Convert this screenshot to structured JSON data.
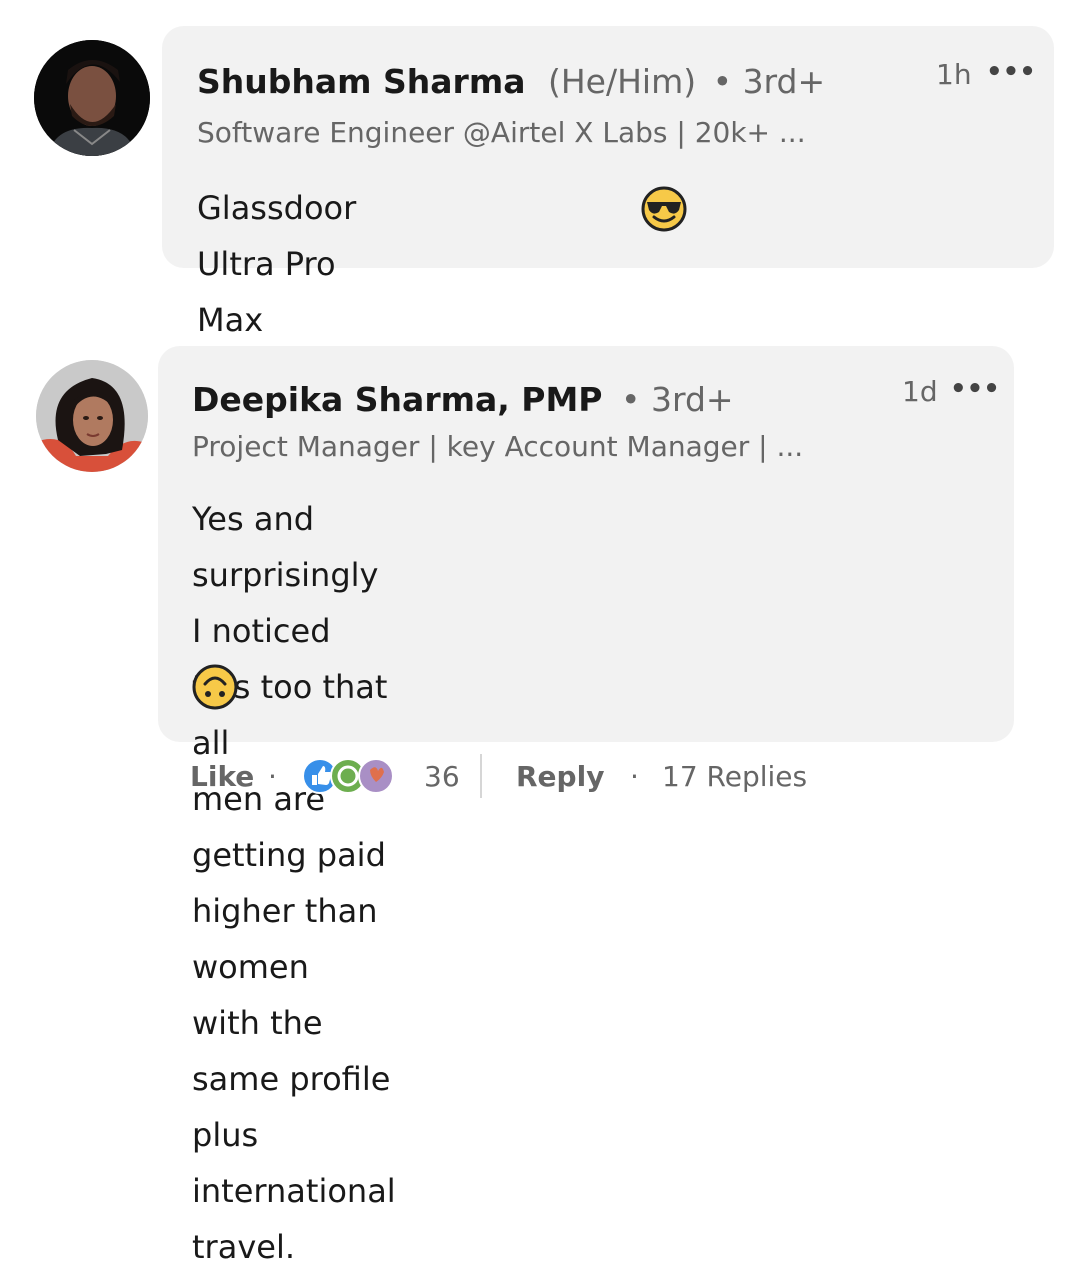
{
  "comments": [
    {
      "author": "Shubham Sharma",
      "pronouns": "(He/Him)",
      "degree": "• 3rd+",
      "headline": "Software Engineer @Airtel X Labs | 20k+ ...",
      "time": "1h",
      "more_icon": "•••",
      "text": "Glassdoor Ultra Pro Max",
      "emoji": "smiling-face-with-sunglasses-icon"
    },
    {
      "author": "Deepika Sharma, PMP",
      "degree": "• 3rd+",
      "headline": "Project Manager | key Account Manager | ...",
      "time": "1d",
      "more_icon": "•••",
      "text_lines": [
        "Yes and surprisingly I noticed this too that all",
        "men are getting paid higher than women",
        "with the same profile plus international travel."
      ],
      "emoji": "upside-down-face-icon"
    }
  ],
  "actions": {
    "like": "Like",
    "dot1": "·",
    "reaction_count": "36",
    "reply": "Reply",
    "dot2": "·",
    "replies": "17 Replies"
  },
  "colors": {
    "bubble": "#f2f2f2",
    "like_blue": "#378fe9",
    "celebrate_green": "#44712e",
    "love_red": "#df704d",
    "emoji_yellow": "#f7c948"
  }
}
